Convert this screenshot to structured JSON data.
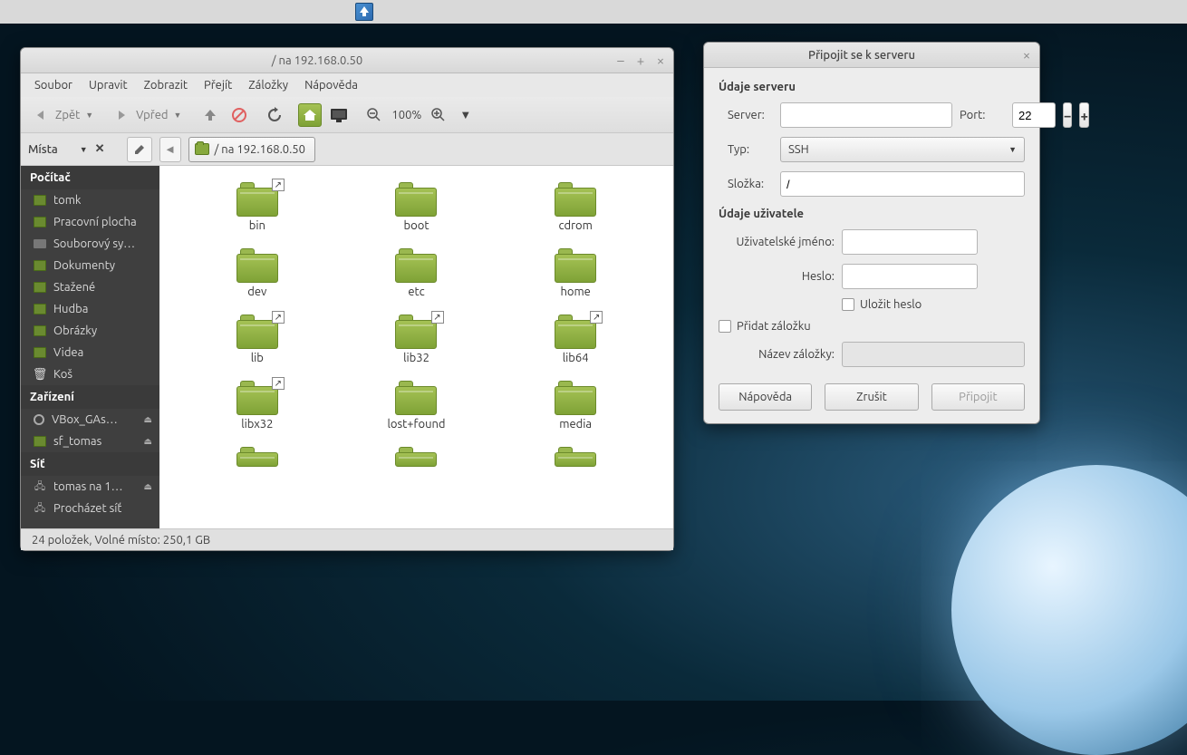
{
  "topPanel": {
    "launcherIcon": "inkscape"
  },
  "fm": {
    "title": "/ na 192.168.0.50",
    "menubar": [
      "Soubor",
      "Upravit",
      "Zobrazit",
      "Přejít",
      "Záložky",
      "Nápověda"
    ],
    "toolbar": {
      "back": "Zpět",
      "forward": "Vpřed",
      "zoom": "100%"
    },
    "pathbar": {
      "places": "Místa",
      "breadcrumb": "/ na 192.168.0.50"
    },
    "sidebar": {
      "sections": [
        {
          "title": "Počítač",
          "items": [
            {
              "icon": "folder",
              "label": "tomk"
            },
            {
              "icon": "folder",
              "label": "Pracovní plocha"
            },
            {
              "icon": "drive",
              "label": "Souborový sy…"
            },
            {
              "icon": "folder",
              "label": "Dokumenty"
            },
            {
              "icon": "folder",
              "label": "Stažené"
            },
            {
              "icon": "folder",
              "label": "Hudba"
            },
            {
              "icon": "folder",
              "label": "Obrázky"
            },
            {
              "icon": "folder",
              "label": "Videa"
            },
            {
              "icon": "trash",
              "label": "Koš"
            }
          ]
        },
        {
          "title": "Zařízení",
          "items": [
            {
              "icon": "disk",
              "label": "VBox_GAs…",
              "eject": true
            },
            {
              "icon": "folder",
              "label": "sf_tomas",
              "eject": true
            }
          ]
        },
        {
          "title": "Síť",
          "items": [
            {
              "icon": "net",
              "label": "tomas na 1…",
              "eject": true
            },
            {
              "icon": "net",
              "label": "Procházet síť"
            }
          ]
        }
      ]
    },
    "files": [
      {
        "name": "bin",
        "link": true
      },
      {
        "name": "boot"
      },
      {
        "name": "cdrom"
      },
      {
        "name": "dev"
      },
      {
        "name": "etc"
      },
      {
        "name": "home"
      },
      {
        "name": "lib",
        "link": true
      },
      {
        "name": "lib32",
        "link": true
      },
      {
        "name": "lib64",
        "link": true
      },
      {
        "name": "libx32",
        "link": true
      },
      {
        "name": "lost+found"
      },
      {
        "name": "media"
      },
      {
        "name": "",
        "partial": true
      },
      {
        "name": "",
        "partial": true
      },
      {
        "name": "",
        "partial": true
      }
    ],
    "status": "24 položek, Volné místo: 250,1 GB"
  },
  "dialog": {
    "title": "Připojit se k serveru",
    "sectionServer": "Údaje serveru",
    "labels": {
      "server": "Server:",
      "port": "Port:",
      "type": "Typ:",
      "folder": "Složka:",
      "username": "Uživatelské jméno:",
      "password": "Heslo:",
      "savePass": "Uložit heslo",
      "addBookmark": "Přidat záložku",
      "bookmarkName": "Název záložky:"
    },
    "values": {
      "port": "22",
      "type": "SSH",
      "folder": "/"
    },
    "sectionUser": "Údaje uživatele",
    "buttons": {
      "help": "Nápověda",
      "cancel": "Zrušit",
      "connect": "Připojit"
    }
  }
}
